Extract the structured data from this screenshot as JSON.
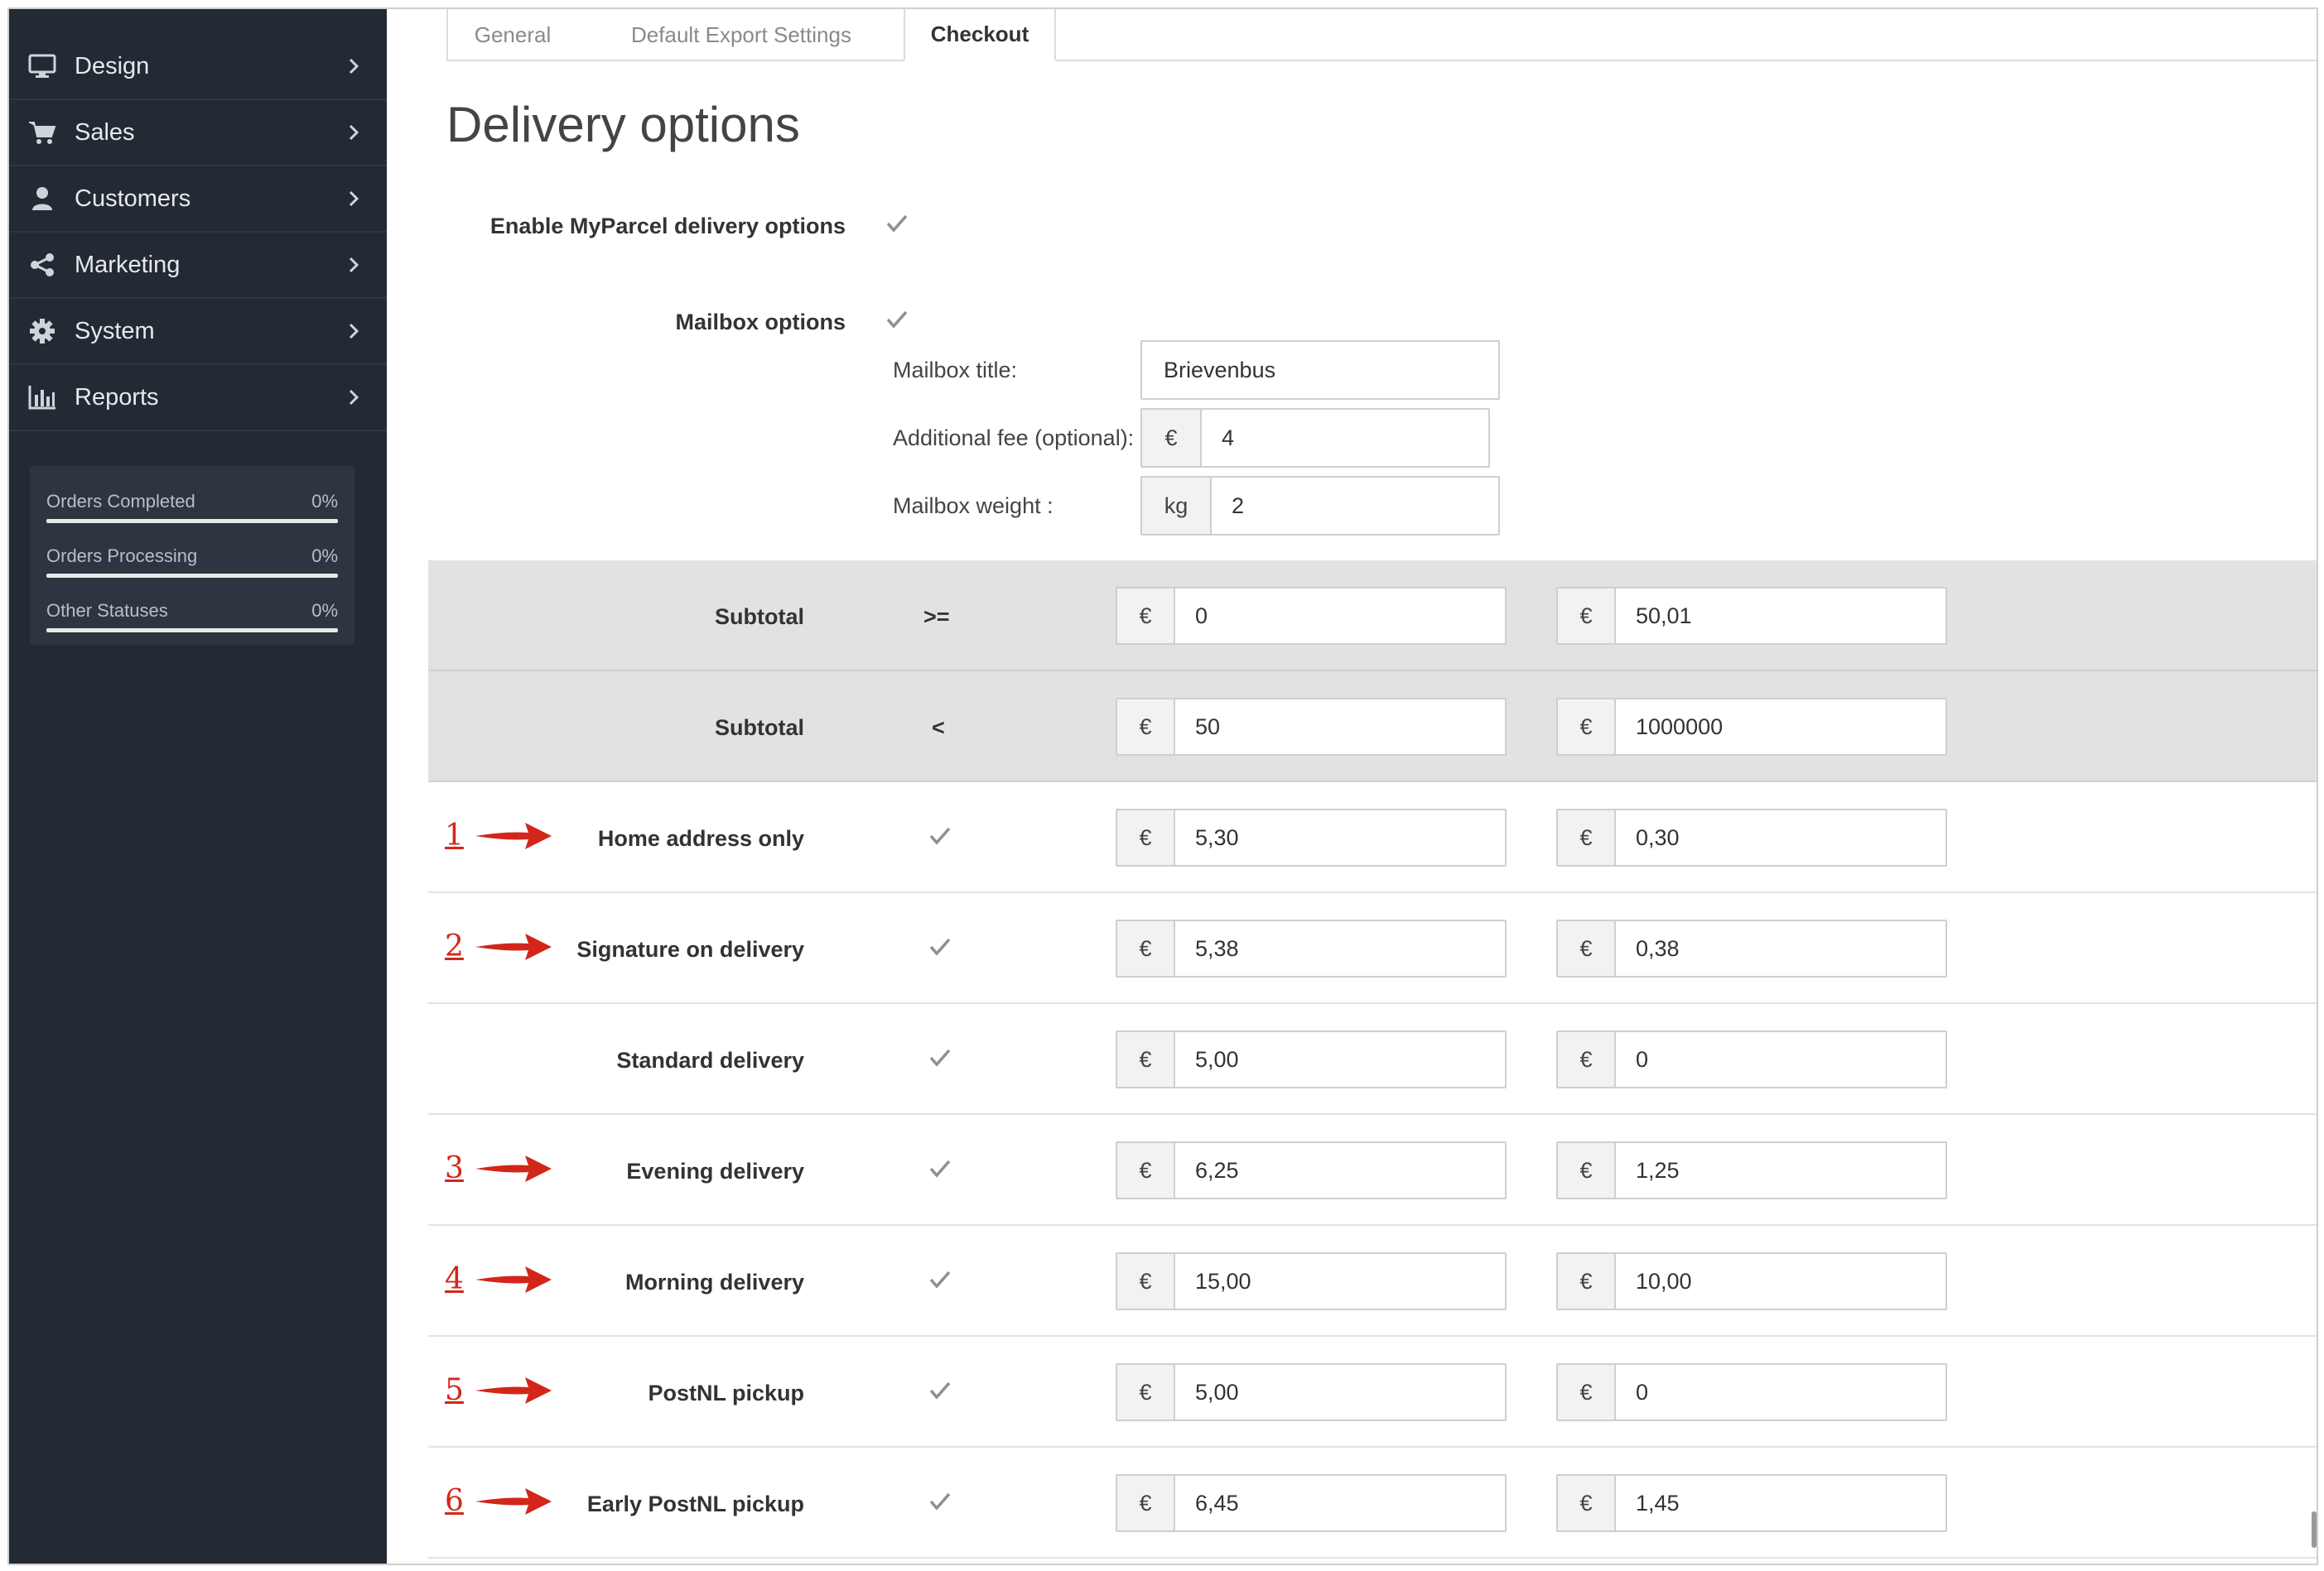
{
  "sidebar": {
    "items": [
      {
        "label": "Design",
        "icon": "monitor-icon"
      },
      {
        "label": "Sales",
        "icon": "cart-icon"
      },
      {
        "label": "Customers",
        "icon": "user-icon"
      },
      {
        "label": "Marketing",
        "icon": "share-icon"
      },
      {
        "label": "System",
        "icon": "gear-icon"
      },
      {
        "label": "Reports",
        "icon": "bar-chart-icon"
      }
    ],
    "stats": [
      {
        "label": "Orders Completed",
        "value": "0%"
      },
      {
        "label": "Orders Processing",
        "value": "0%"
      },
      {
        "label": "Other Statuses",
        "value": "0%"
      }
    ]
  },
  "tabs": [
    {
      "label": "General",
      "active": false
    },
    {
      "label": "Default Export Settings",
      "active": false
    },
    {
      "label": "Checkout",
      "active": true
    }
  ],
  "page_title": "Delivery options",
  "enable_label": "Enable MyParcel delivery options",
  "mailbox": {
    "label": "Mailbox options",
    "title_label": "Mailbox title:",
    "title_value": "Brievenbus",
    "fee_label": "Additional fee (optional):",
    "fee_addon": "€",
    "fee_value": "4",
    "weight_label": "Mailbox weight :",
    "weight_addon": "kg",
    "weight_value": "2"
  },
  "subtotal_rows": [
    {
      "label": "Subtotal",
      "operator": ">=",
      "col1": "0",
      "col2": "50,01"
    },
    {
      "label": "Subtotal",
      "operator": "<",
      "col1": "50",
      "col2": "1000000"
    }
  ],
  "currency": "€",
  "options": [
    {
      "marker": "1",
      "label": "Home address only",
      "col1": "5,30",
      "col2": "0,30"
    },
    {
      "marker": "2",
      "label": "Signature on delivery",
      "col1": "5,38",
      "col2": "0,38"
    },
    {
      "marker": "",
      "label": "Standard delivery",
      "col1": "5,00",
      "col2": "0"
    },
    {
      "marker": "3",
      "label": "Evening delivery",
      "col1": "6,25",
      "col2": "1,25"
    },
    {
      "marker": "4",
      "label": "Morning delivery",
      "col1": "15,00",
      "col2": "10,00"
    },
    {
      "marker": "5",
      "label": "PostNL pickup",
      "col1": "5,00",
      "col2": "0"
    },
    {
      "marker": "6",
      "label": "Early PostNL pickup",
      "col1": "6,45",
      "col2": "1,45"
    }
  ],
  "colors": {
    "sidebar_bg": "#232a34",
    "marker_red": "#d3261a",
    "accent": "#2bb5d8"
  }
}
